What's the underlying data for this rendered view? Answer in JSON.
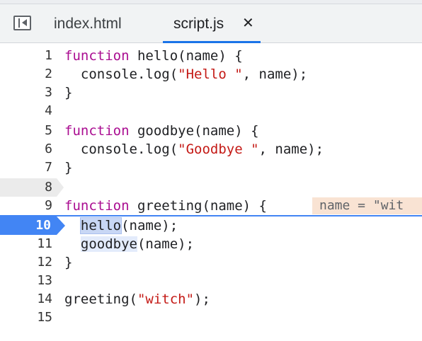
{
  "tabs": [
    {
      "label": "index.html",
      "active": false
    },
    {
      "label": "script.js",
      "active": true,
      "close_glyph": "✕"
    }
  ],
  "editor": {
    "current_line": 10,
    "inline_value": "name = \"wit",
    "lines": [
      {
        "n": "1",
        "text": "function hello(name) {"
      },
      {
        "n": "2",
        "text": "  console.log(\"Hello \", name);"
      },
      {
        "n": "3",
        "text": "}"
      },
      {
        "n": "4",
        "text": ""
      },
      {
        "n": "5",
        "text": "function goodbye(name) {"
      },
      {
        "n": "6",
        "text": "  console.log(\"Goodbye \", name);"
      },
      {
        "n": "7",
        "text": "}"
      },
      {
        "n": "8",
        "text": ""
      },
      {
        "n": "9",
        "text": "function greeting(name) {"
      },
      {
        "n": "10",
        "text": "  hello(name);"
      },
      {
        "n": "11",
        "text": "  goodbye(name);"
      },
      {
        "n": "12",
        "text": "}"
      },
      {
        "n": "13",
        "text": ""
      },
      {
        "n": "14",
        "text": "greeting(\"witch\");"
      },
      {
        "n": "15",
        "text": ""
      }
    ]
  },
  "colors": {
    "keyword": "#aa0d91",
    "string": "#c41a16",
    "execution_line": "#4285f4",
    "inline_value_bg": "#f9e3d3"
  }
}
